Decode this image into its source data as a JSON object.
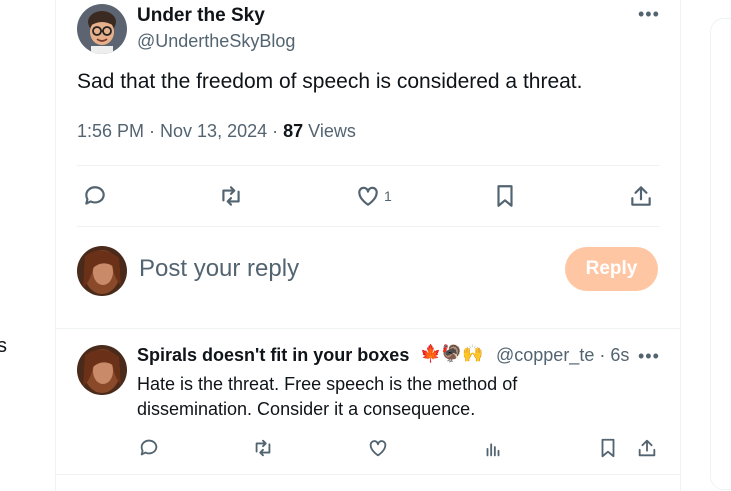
{
  "left_edge": {
    "glyph": "s"
  },
  "tweet": {
    "author_name": "Under the Sky",
    "author_handle": "@UndertheSkyBlog",
    "more": "•••",
    "text": "Sad that the freedom of speech is considered a threat.",
    "time": "1:56 PM · Nov 13, 2024 · ",
    "views_count": "87",
    "views_label": " Views",
    "actions": {
      "reply_icon": "reply-icon",
      "retweet_icon": "retweet-icon",
      "like_icon": "heart-icon",
      "like_count": "1",
      "bookmark_icon": "bookmark-icon",
      "share_icon": "share-icon"
    }
  },
  "compose": {
    "placeholder": "Post your reply",
    "button": "Reply",
    "button_color": "#ffc6a4"
  },
  "reply": {
    "author_name": "Spirals doesn't fit in your boxes",
    "emojis": "🍁🦃🙌",
    "handle_time": "@copper_te · 6s",
    "more": "•••",
    "text": "Hate is the threat. Free speech is the method of dissemination. Consider it a consequence."
  },
  "colors": {
    "text": "#0f1419",
    "muted": "#536471",
    "border": "#eff3f4"
  }
}
